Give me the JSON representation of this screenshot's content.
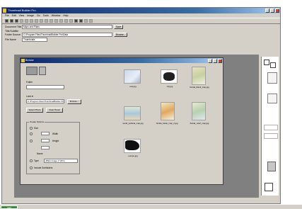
{
  "window": {
    "title": "Thumbnail Builder Pro",
    "controls": [
      "minimize",
      "maximize",
      "close"
    ]
  },
  "menu": [
    "File",
    "Edit",
    "View",
    "Image",
    "Go",
    "Tools",
    "Window",
    "Help"
  ],
  "form": {
    "rows": [
      {
        "label": "Document Title",
        "value": "Maps and Plans"
      },
      {
        "label": "Title/Subtitle",
        "value": ""
      },
      {
        "label": "Folder Source",
        "value": "C:\\Program Files\\ThumbnailBuilder Pro\\Data"
      },
      {
        "label": "File Name",
        "value": "Thumbnails"
      }
    ],
    "save_label": "Save",
    "browse_label": "Browse..."
  },
  "dialog": {
    "title": "Browse",
    "left": {
      "label1": "Folder",
      "label2": "Look in",
      "path": "C:\\Program Files\\ThumbnailBuilder Pro\\Data",
      "browse_label": "Browse...",
      "btn1": "Select Photo",
      "btn2": "Clear Panel",
      "group_title": "Create Options",
      "opt1": "Size",
      "opt2": "Width",
      "opt3": "Height",
      "opt4": "Name",
      "dropdown_label": "Type",
      "dropdown_value": "JPEG Image (*.JPG)",
      "checkbox_label": "Include Subfolders"
    },
    "gallery": [
      {
        "label": "usa.jpg"
      },
      {
        "label": "city.jpg"
      },
      {
        "label": "florida_blank_map.jpg"
      },
      {
        "label": "world_political_map.jpg"
      },
      {
        "label": "florida_blank_map_2.jpg"
      },
      {
        "label": "florida_relief_map.jpg"
      },
      {
        "label": "europe.jpg"
      }
    ]
  },
  "taskbar": {
    "start_label": "start"
  }
}
